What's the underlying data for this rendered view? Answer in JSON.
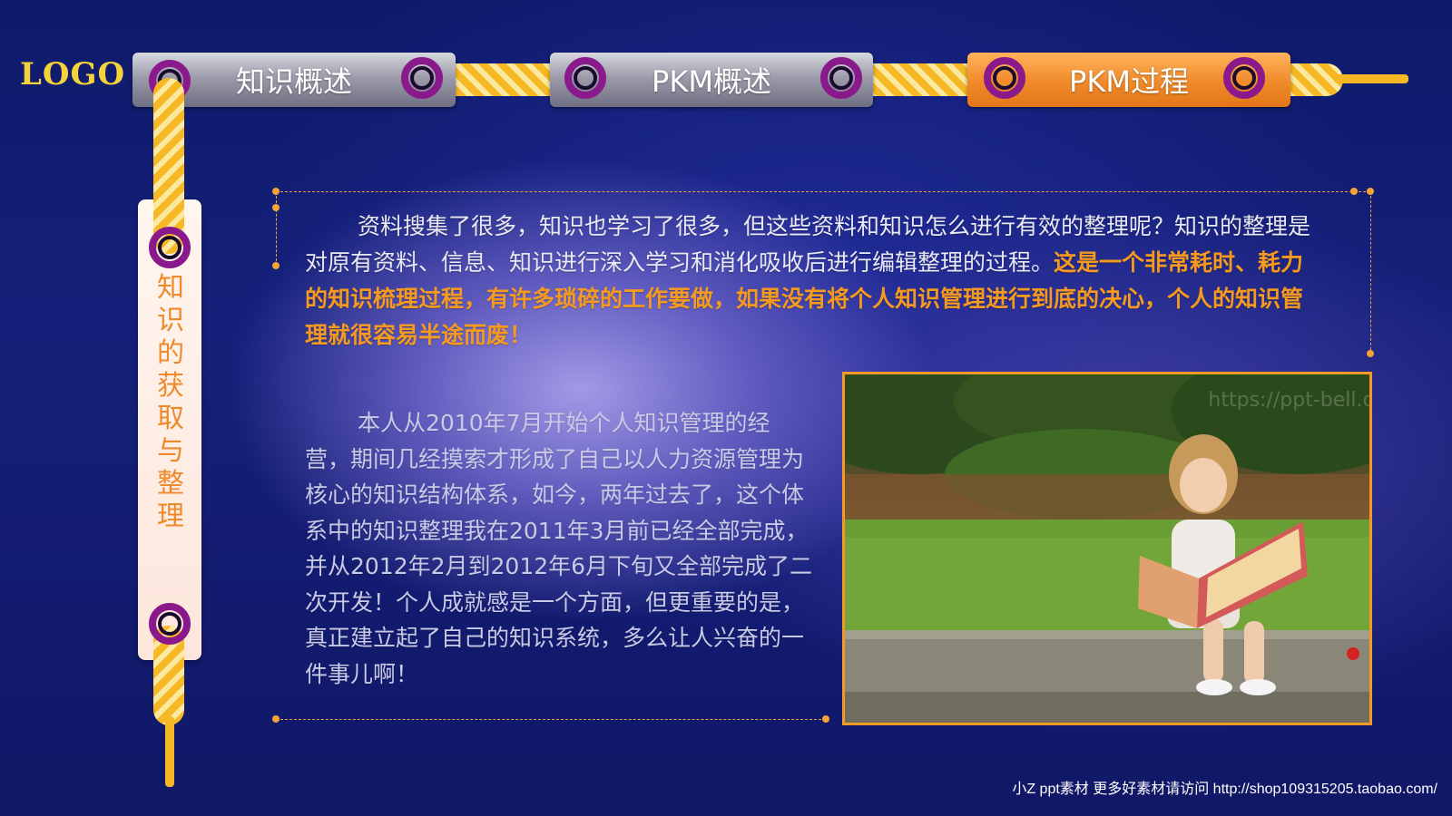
{
  "logo": "LOGO",
  "nav": {
    "tabs": [
      {
        "label": "知识概述",
        "active": false
      },
      {
        "label": "PKM概述",
        "active": false
      },
      {
        "label": "PKM过程",
        "active": true
      }
    ]
  },
  "side_title": "知\n识\n的\n获\n取\n与\n整\n理",
  "content": {
    "para1_normal": "资料搜集了很多，知识也学习了很多，但这些资料和知识怎么进行有效的整理呢？知识的整理是对原有资料、信息、知识进行深入学习和消化吸收后进行编辑整理的过程。",
    "para1_highlight": "这是一个非常耗时、耗力的知识梳理过程，有许多琐碎的工作要做，如果没有将个人知识管理进行到底的决心，个人的知识管理就很容易半途而废！",
    "para2": "本人从2010年7月开始个人知识管理的经营，期间几经摸索才形成了自己以人力资源管理为核心的知识结构体系，如今，两年过去了，这个体系中的知识整理我在2011年3月前已经全部完成，并从2012年2月到2012年6月下旬又全部完成了二次开发！个人成就感是一个方面，但更重要的是，真正建立起了自己的知识系统，多么让人兴奋的一件事儿啊！"
  },
  "photo": {
    "watermark": "https://ppt-bell.de"
  },
  "footer": "小Z ppt素材 更多好素材请访问 http://shop109315205.taobao.com/",
  "colors": {
    "accent_orange": "#f59a1e",
    "rope_yellow": "#f7b825",
    "ring_purple": "#8a1a8c",
    "background": "#15207a"
  }
}
